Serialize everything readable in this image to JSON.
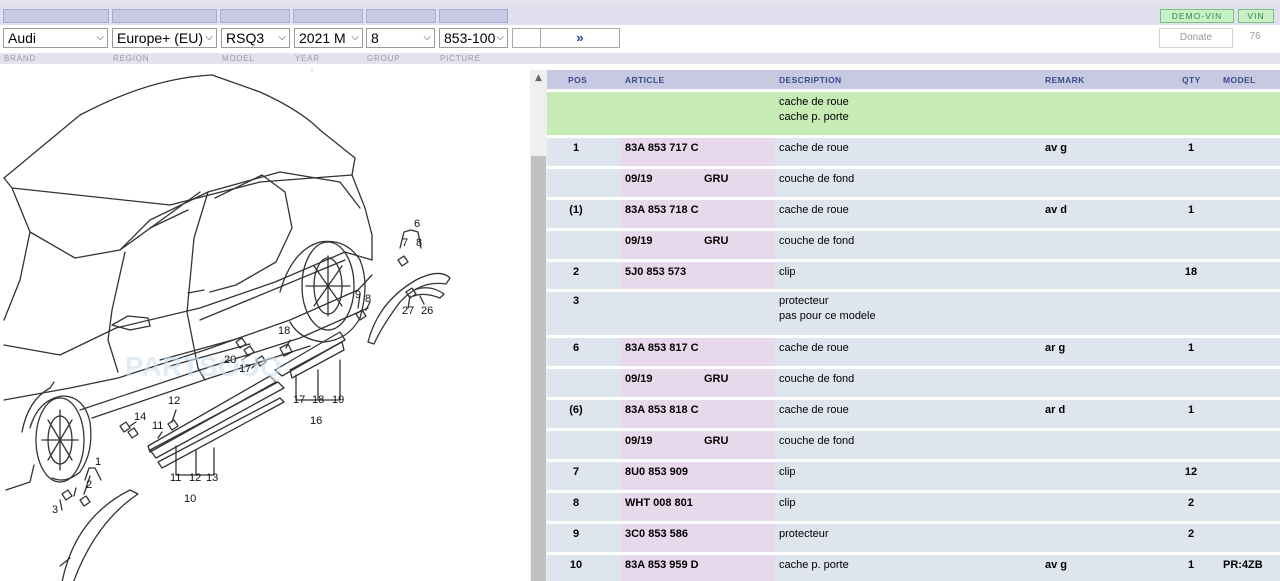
{
  "toolbar": {
    "demo_vin_label": "DEMO-VIN",
    "vin_label": "VIN",
    "prev_label": "«",
    "next_label": "»",
    "donate_label": "Donate",
    "counter": "76"
  },
  "filters": {
    "brand": {
      "label": "BRAND",
      "value": "Audi"
    },
    "region": {
      "label": "REGION",
      "value": "Europe+ (EU)"
    },
    "model": {
      "label": "MODEL",
      "value": "RSQ3"
    },
    "year": {
      "label": "YEAR",
      "value": "2021  M"
    },
    "group": {
      "label": "GROUP",
      "value": "8"
    },
    "picture": {
      "label": "PICTURE",
      "value": "853-100"
    }
  },
  "diagram": {
    "watermark": "PARTSOUQ",
    "callouts": [
      "1",
      "2",
      "3",
      "6",
      "7",
      "8",
      "9",
      "8",
      "27",
      "26",
      "18",
      "20",
      "17",
      "12",
      "14",
      "11",
      "17",
      "18",
      "19",
      "16",
      "11",
      "12",
      "13",
      "10"
    ]
  },
  "table": {
    "columns": {
      "pos": "POS",
      "article": "ARTICLE",
      "description": "DESCRIPTION",
      "remark": "REMARK",
      "qty": "QTY",
      "model": "MODEL"
    },
    "group_row": {
      "line1": "cache de roue",
      "line2": "cache p. porte"
    },
    "rows": [
      {
        "pos": "1",
        "article": "83A 853 717 C",
        "description": "cache de roue",
        "remark": "av g",
        "qty": "1",
        "model": ""
      },
      {
        "pos": "",
        "article": "09/19",
        "extra": "GRU",
        "description": "couche de fond",
        "remark": "",
        "qty": "",
        "model": ""
      },
      {
        "pos": "(1)",
        "article": "83A 853 718 C",
        "description": "cache de roue",
        "remark": "av d",
        "qty": "1",
        "model": ""
      },
      {
        "pos": "",
        "article": "09/19",
        "extra": "GRU",
        "description": "couche de fond",
        "remark": "",
        "qty": "",
        "model": ""
      },
      {
        "pos": "2",
        "article": "5J0 853 573",
        "description": "clip",
        "remark": "",
        "qty": "18",
        "model": ""
      },
      {
        "pos": "3",
        "article": "",
        "description": "protecteur",
        "description2": "pas pour ce modele",
        "remark": "",
        "qty": "",
        "model": ""
      },
      {
        "pos": "6",
        "article": "83A 853 817 C",
        "description": "cache de roue",
        "remark": "ar g",
        "qty": "1",
        "model": ""
      },
      {
        "pos": "",
        "article": "09/19",
        "extra": "GRU",
        "description": "couche de fond",
        "remark": "",
        "qty": "",
        "model": ""
      },
      {
        "pos": "(6)",
        "article": "83A 853 818 C",
        "description": "cache de roue",
        "remark": "ar d",
        "qty": "1",
        "model": ""
      },
      {
        "pos": "",
        "article": "09/19",
        "extra": "GRU",
        "description": "couche de fond",
        "remark": "",
        "qty": "",
        "model": ""
      },
      {
        "pos": "7",
        "article": "8U0 853 909",
        "description": "clip",
        "remark": "",
        "qty": "12",
        "model": ""
      },
      {
        "pos": "8",
        "article": "WHT 008 801",
        "description": "clip",
        "remark": "",
        "qty": "2",
        "model": ""
      },
      {
        "pos": "9",
        "article": "3C0 853 586",
        "description": "protecteur",
        "remark": "",
        "qty": "2",
        "model": ""
      },
      {
        "pos": "10",
        "article": "83A 853 959 D",
        "description": "cache p. porte",
        "remark": "av g",
        "qty": "1",
        "model": "PR:4ZB"
      }
    ]
  },
  "colors": {
    "header_bg": "#c7c9e2",
    "group_row_bg": "#c6ebb5",
    "row_bg": "#dfe5ef",
    "article_cell_bg": "#e8d8ec",
    "vin_green": "#2f8a3a"
  }
}
